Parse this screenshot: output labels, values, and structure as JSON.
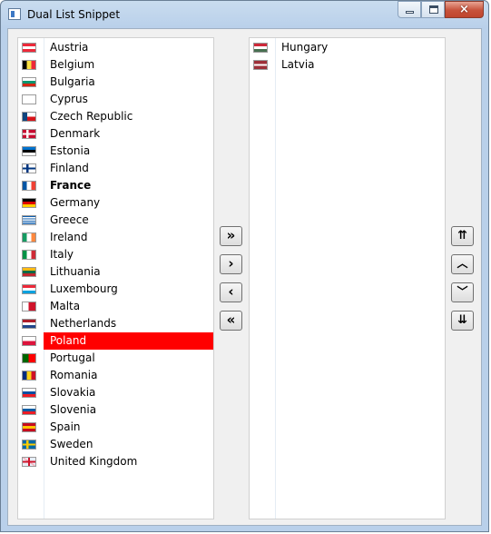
{
  "window": {
    "title": "Dual List Snippet",
    "close_glyph": "×"
  },
  "left_list": [
    {
      "name": "Austria",
      "flag": "at",
      "colors": [
        "#ed2939",
        "#ffffff",
        "#ed2939"
      ],
      "dir": "h"
    },
    {
      "name": "Belgium",
      "flag": "be",
      "colors": [
        "#000000",
        "#fae042",
        "#ed2939"
      ],
      "dir": "v"
    },
    {
      "name": "Bulgaria",
      "flag": "bg",
      "colors": [
        "#ffffff",
        "#00966e",
        "#d62612"
      ],
      "dir": "h"
    },
    {
      "name": "Cyprus",
      "flag": "cy",
      "colors": [
        "#ffffff",
        "#ffffff",
        "#ffffff"
      ],
      "dir": "h"
    },
    {
      "name": "Czech Republic",
      "flag": "cz",
      "colors": [
        "#ffffff",
        "#d7141a",
        "#11457e"
      ],
      "dir": "cz"
    },
    {
      "name": "Denmark",
      "flag": "dk",
      "colors": [
        "#c60c30",
        "#ffffff"
      ],
      "dir": "cross"
    },
    {
      "name": "Estonia",
      "flag": "ee",
      "colors": [
        "#0072ce",
        "#000000",
        "#ffffff"
      ],
      "dir": "h"
    },
    {
      "name": "Finland",
      "flag": "fi",
      "colors": [
        "#ffffff",
        "#003580"
      ],
      "dir": "cross"
    },
    {
      "name": "France",
      "flag": "fr",
      "colors": [
        "#0055a4",
        "#ffffff",
        "#ef4135"
      ],
      "dir": "v"
    },
    {
      "name": "Germany",
      "flag": "de",
      "colors": [
        "#000000",
        "#dd0000",
        "#ffce00"
      ],
      "dir": "h"
    },
    {
      "name": "Greece",
      "flag": "gr",
      "colors": [
        "#0d5eaf",
        "#ffffff",
        "#0d5eaf"
      ],
      "dir": "stripes"
    },
    {
      "name": "Ireland",
      "flag": "ie",
      "colors": [
        "#169b62",
        "#ffffff",
        "#ff883e"
      ],
      "dir": "v"
    },
    {
      "name": "Italy",
      "flag": "it",
      "colors": [
        "#009246",
        "#ffffff",
        "#ce2b37"
      ],
      "dir": "v"
    },
    {
      "name": "Lithuania",
      "flag": "lt",
      "colors": [
        "#fdb913",
        "#006a44",
        "#c1272d"
      ],
      "dir": "h"
    },
    {
      "name": "Luxembourg",
      "flag": "lu",
      "colors": [
        "#ed2939",
        "#ffffff",
        "#00a1de"
      ],
      "dir": "h"
    },
    {
      "name": "Malta",
      "flag": "mt",
      "colors": [
        "#ffffff",
        "#cf142b"
      ],
      "dir": "v2"
    },
    {
      "name": "Netherlands",
      "flag": "nl",
      "colors": [
        "#ae1c28",
        "#ffffff",
        "#21468b"
      ],
      "dir": "h"
    },
    {
      "name": "Poland",
      "flag": "pl",
      "colors": [
        "#ffffff",
        "#dc143c"
      ],
      "dir": "h2"
    },
    {
      "name": "Portugal",
      "flag": "pt",
      "colors": [
        "#006600",
        "#ff0000"
      ],
      "dir": "v2"
    },
    {
      "name": "Romania",
      "flag": "ro",
      "colors": [
        "#002b7f",
        "#fcd116",
        "#ce1126"
      ],
      "dir": "v"
    },
    {
      "name": "Slovakia",
      "flag": "sk",
      "colors": [
        "#ffffff",
        "#0b4ea2",
        "#ee1c25"
      ],
      "dir": "h"
    },
    {
      "name": "Slovenia",
      "flag": "si",
      "colors": [
        "#ffffff",
        "#005da4",
        "#ed1c24"
      ],
      "dir": "h"
    },
    {
      "name": "Spain",
      "flag": "es",
      "colors": [
        "#c60b1e",
        "#ffc400",
        "#c60b1e"
      ],
      "dir": "h"
    },
    {
      "name": "Sweden",
      "flag": "se",
      "colors": [
        "#006aa7",
        "#fecc00"
      ],
      "dir": "cross"
    },
    {
      "name": "United Kingdom",
      "flag": "gb",
      "colors": [
        "#e8eef7",
        "#cf142b"
      ],
      "dir": "uk"
    }
  ],
  "left_state": {
    "bold_item": "France",
    "selected_item": "Poland",
    "selected_color": "#ff0000"
  },
  "right_list": [
    {
      "name": "Hungary",
      "flag": "hu",
      "colors": [
        "#ce2939",
        "#ffffff",
        "#477050"
      ],
      "dir": "h"
    },
    {
      "name": "Latvia",
      "flag": "lv",
      "colors": [
        "#9e3039",
        "#ffffff",
        "#9e3039"
      ],
      "dir": "lv"
    }
  ],
  "buttons": {
    "move_all_right": "»",
    "move_right": "›",
    "move_left": "‹",
    "move_all_left": "«",
    "move_top": "⇈",
    "move_up": "︿",
    "move_down": "﹀",
    "move_bottom": "⇊"
  }
}
